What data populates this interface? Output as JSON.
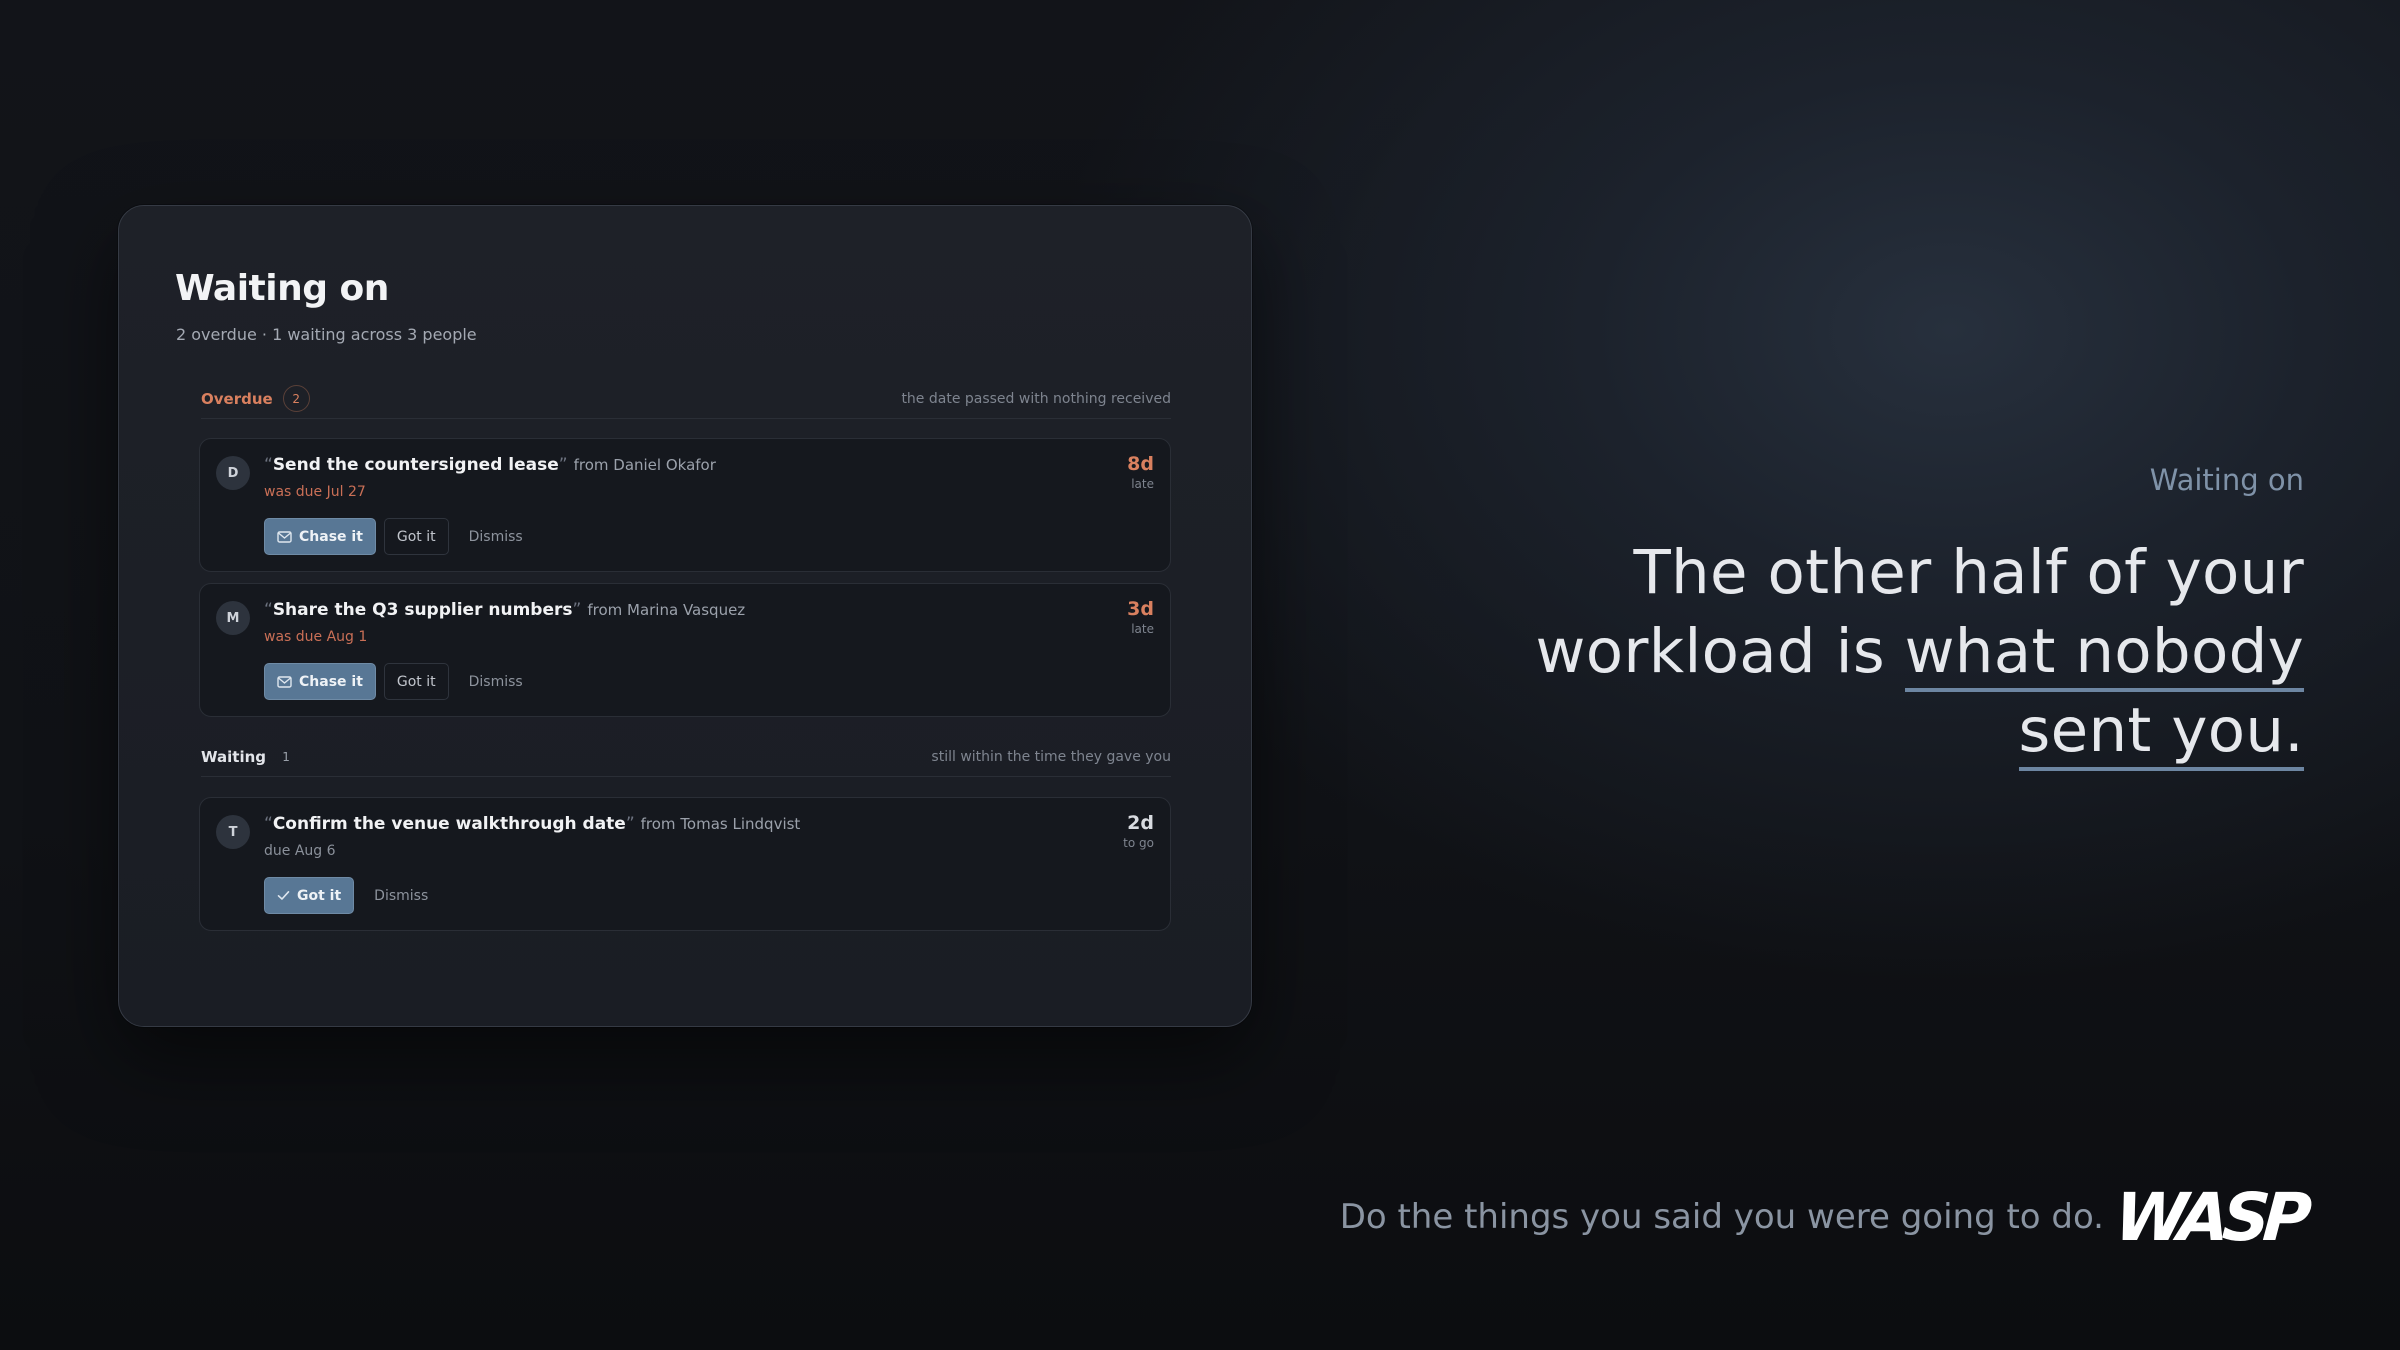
{
  "card": {
    "title": "Waiting on",
    "subtitle": "2 overdue · 1 waiting across 3 people",
    "sections": {
      "overdue": {
        "label": "Overdue",
        "count": "2",
        "note": "the date passed with nothing received"
      },
      "waiting": {
        "label": "Waiting",
        "count": "1",
        "note": "still within the time they gave you"
      }
    },
    "items": [
      {
        "initial": "D",
        "text": "Send the countersigned lease",
        "from": "from Daniel Okafor",
        "due": "was due Jul 27",
        "age": "8d",
        "age_sub": "late",
        "primary_label": "Chase it",
        "secondary_label": "Got it",
        "ghost_label": "Dismiss",
        "status": "overdue"
      },
      {
        "initial": "M",
        "text": "Share the Q3 supplier numbers",
        "from": "from Marina Vasquez",
        "due": "was due Aug 1",
        "age": "3d",
        "age_sub": "late",
        "primary_label": "Chase it",
        "secondary_label": "Got it",
        "ghost_label": "Dismiss",
        "status": "overdue"
      },
      {
        "initial": "T",
        "text": "Confirm the venue walkthrough date",
        "from": "from Tomas Lindqvist",
        "due": "due Aug 6",
        "age": "2d",
        "age_sub": "to go",
        "primary_label": "Got it",
        "ghost_label": "Dismiss",
        "status": "waiting"
      }
    ],
    "quote_open": "“",
    "quote_close": "”"
  },
  "promo": {
    "eyebrow": "Waiting on",
    "headline_part1": "The other half of your workload is ",
    "headline_highlight1": "what nobody",
    "headline_highlight2": "sent you.",
    "tagline": "Do the things you said you were going to do.",
    "logo": "WASP"
  },
  "icons": {
    "chase": "mail-icon",
    "got_it": "check-icon"
  },
  "colors": {
    "accent": "#587795",
    "overdue": "#d9805f",
    "underline": "#6d86a2"
  }
}
